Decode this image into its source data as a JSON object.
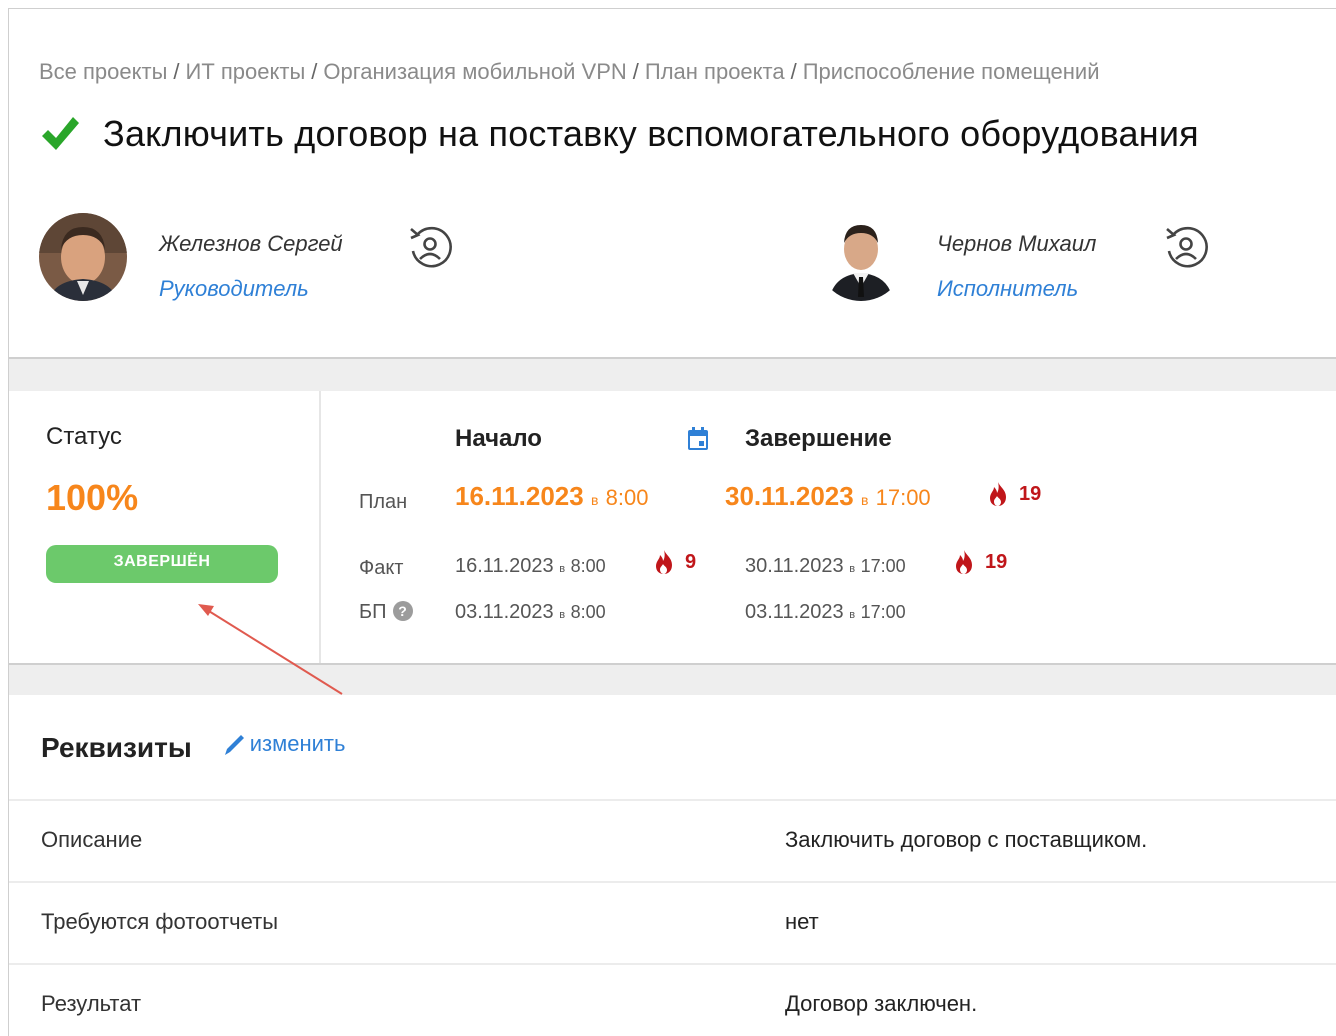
{
  "breadcrumb": [
    "Все проекты",
    "ИТ проекты",
    "Организация мобильной VPN",
    "План проекта",
    "Приспособление помещений"
  ],
  "breadcrumb_separator": "/",
  "task": {
    "title": "Заключить договор на поставку вспомогательного оборудования",
    "done_icon": "check-icon",
    "done_color": "#2aa62a"
  },
  "people": [
    {
      "name": "Железнов Сергей",
      "role": "Руководитель",
      "swap_icon": "user-swap-icon"
    },
    {
      "name": "Чернов Михаил",
      "role": "Исполнитель",
      "swap_icon": "user-swap-icon"
    }
  ],
  "status": {
    "label": "Статус",
    "percent": "100%",
    "badge": "ЗАВЕРШЁН",
    "badge_color": "#6cc96b",
    "percent_color": "#f7861b"
  },
  "dates": {
    "start_header": "Начало",
    "end_header": "Завершение",
    "calendar_icon": "calendar-icon",
    "rows": {
      "plan": {
        "label": "План",
        "start_date": "16.11.2023",
        "start_at": "в",
        "start_time": "8:00",
        "end_date": "30.11.2023",
        "end_at": "в",
        "end_time": "17:00",
        "end_fire": "19"
      },
      "fact": {
        "label": "Факт",
        "start_date": "16.11.2023",
        "start_at": "в",
        "start_time": "8:00",
        "start_fire": "9",
        "end_date": "30.11.2023",
        "end_at": "в",
        "end_time": "17:00",
        "end_fire": "19"
      },
      "bp": {
        "label": "БП",
        "help": "?",
        "start_date": "03.11.2023",
        "start_at": "в",
        "start_time": "8:00",
        "end_date": "03.11.2023",
        "end_at": "в",
        "end_time": "17:00"
      }
    },
    "fire_icon": "fire-icon",
    "fire_color": "#c0161a"
  },
  "requisites": {
    "title": "Реквизиты",
    "edit_label": "изменить",
    "edit_icon": "pencil-icon",
    "rows": [
      {
        "key": "Описание",
        "value": "Заключить договор с поставщиком."
      },
      {
        "key": "Требуются фотоотчеты",
        "value": "нет"
      },
      {
        "key": "Результат",
        "value": "Договор заключен."
      }
    ]
  },
  "colors": {
    "accent": "#2f80d6",
    "orange": "#f7861b",
    "annotation_arrow": "#e05a4f"
  }
}
